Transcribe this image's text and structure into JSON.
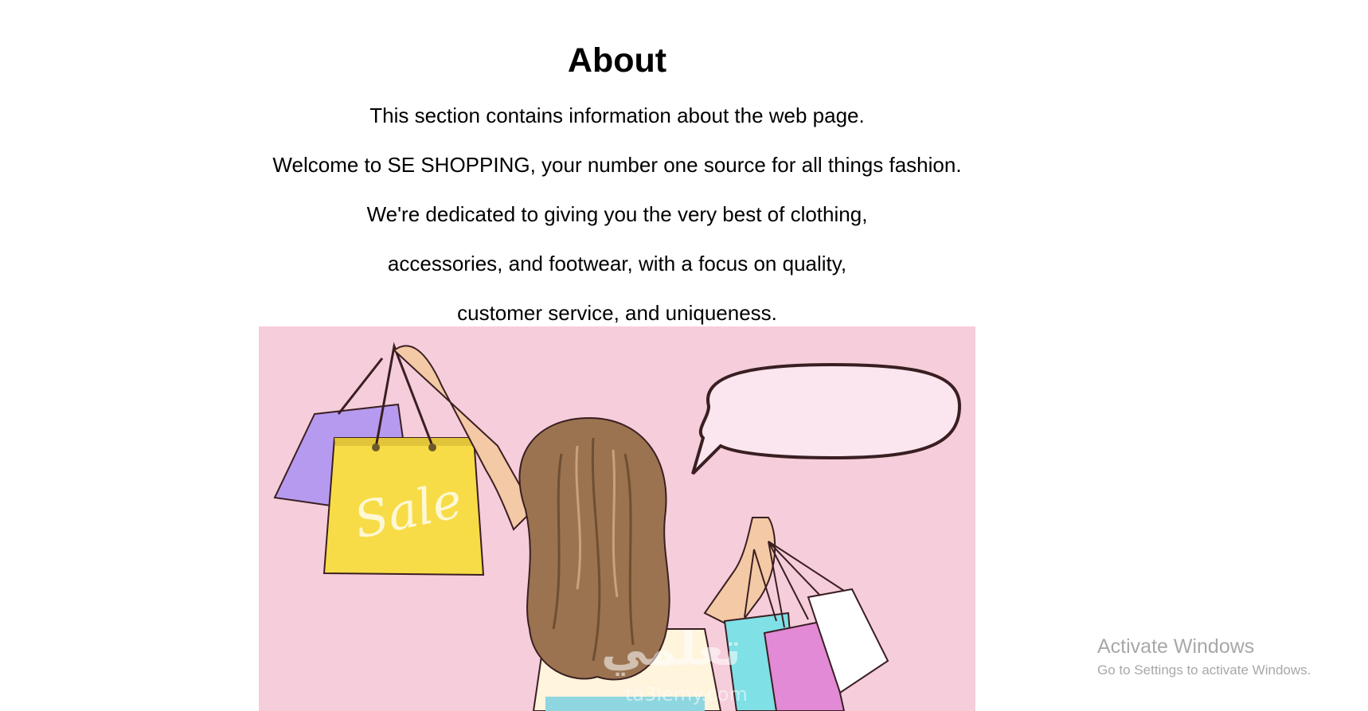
{
  "about": {
    "title": "About",
    "lines": [
      "This section contains information about the web page.",
      "Welcome to SE SHOPPING, your number one source for all things fashion.",
      "We're dedicated to giving you the very best of clothing,",
      "accessories, and footwear, with a focus on quality,",
      "customer service, and uniqueness."
    ]
  },
  "hero_image": {
    "bag_text": "Sale",
    "logo_text": "تعلمي",
    "logo_sub": "ta3lemy.com",
    "colors": {
      "background": "#f6cdda",
      "yellow_bag": "#f7dc47",
      "purple_bag": "#b69af0",
      "cyan_bag": "#7fe0e6",
      "magenta_bag": "#e28ad6",
      "hair": "#9b7350"
    }
  },
  "watermark": {
    "title": "Activate Windows",
    "subtitle": "Go to Settings to activate Windows."
  }
}
